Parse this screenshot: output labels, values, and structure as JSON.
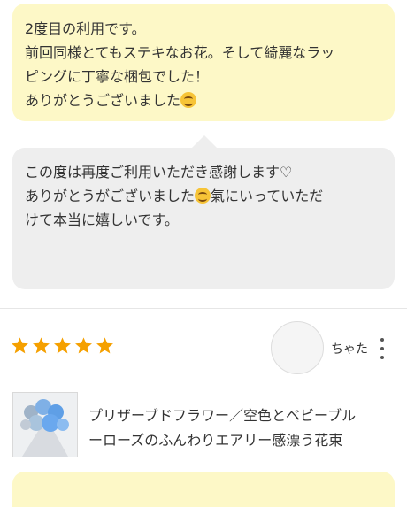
{
  "review": {
    "line1": "2度目の利用です。",
    "line2": "前回同様とてもステキなお花。そして綺麗なラッ",
    "line3": "ピングに丁寧な梱包でした！",
    "line4": "ありがとうございました",
    "emoji": "smiling-face"
  },
  "reply": {
    "line1": "この度は再度ご利用いただき感謝します♡",
    "line2a": "ありがとうがございました",
    "line2b": "氣にいっていただ",
    "line3": "けて本当に嬉しいです。",
    "emoji": "smiling-face"
  },
  "next_review": {
    "rating": 5,
    "rating_max": 5,
    "username": "ちゃた",
    "star_color": "#f5a000"
  },
  "product": {
    "line1": "プリザーブドフラワー／空色とベビーブル",
    "line2": "ーローズのふんわりエアリー感漂う花束"
  },
  "colors": {
    "review_bubble": "#fdf8c7",
    "reply_bubble": "#eeeeee"
  }
}
